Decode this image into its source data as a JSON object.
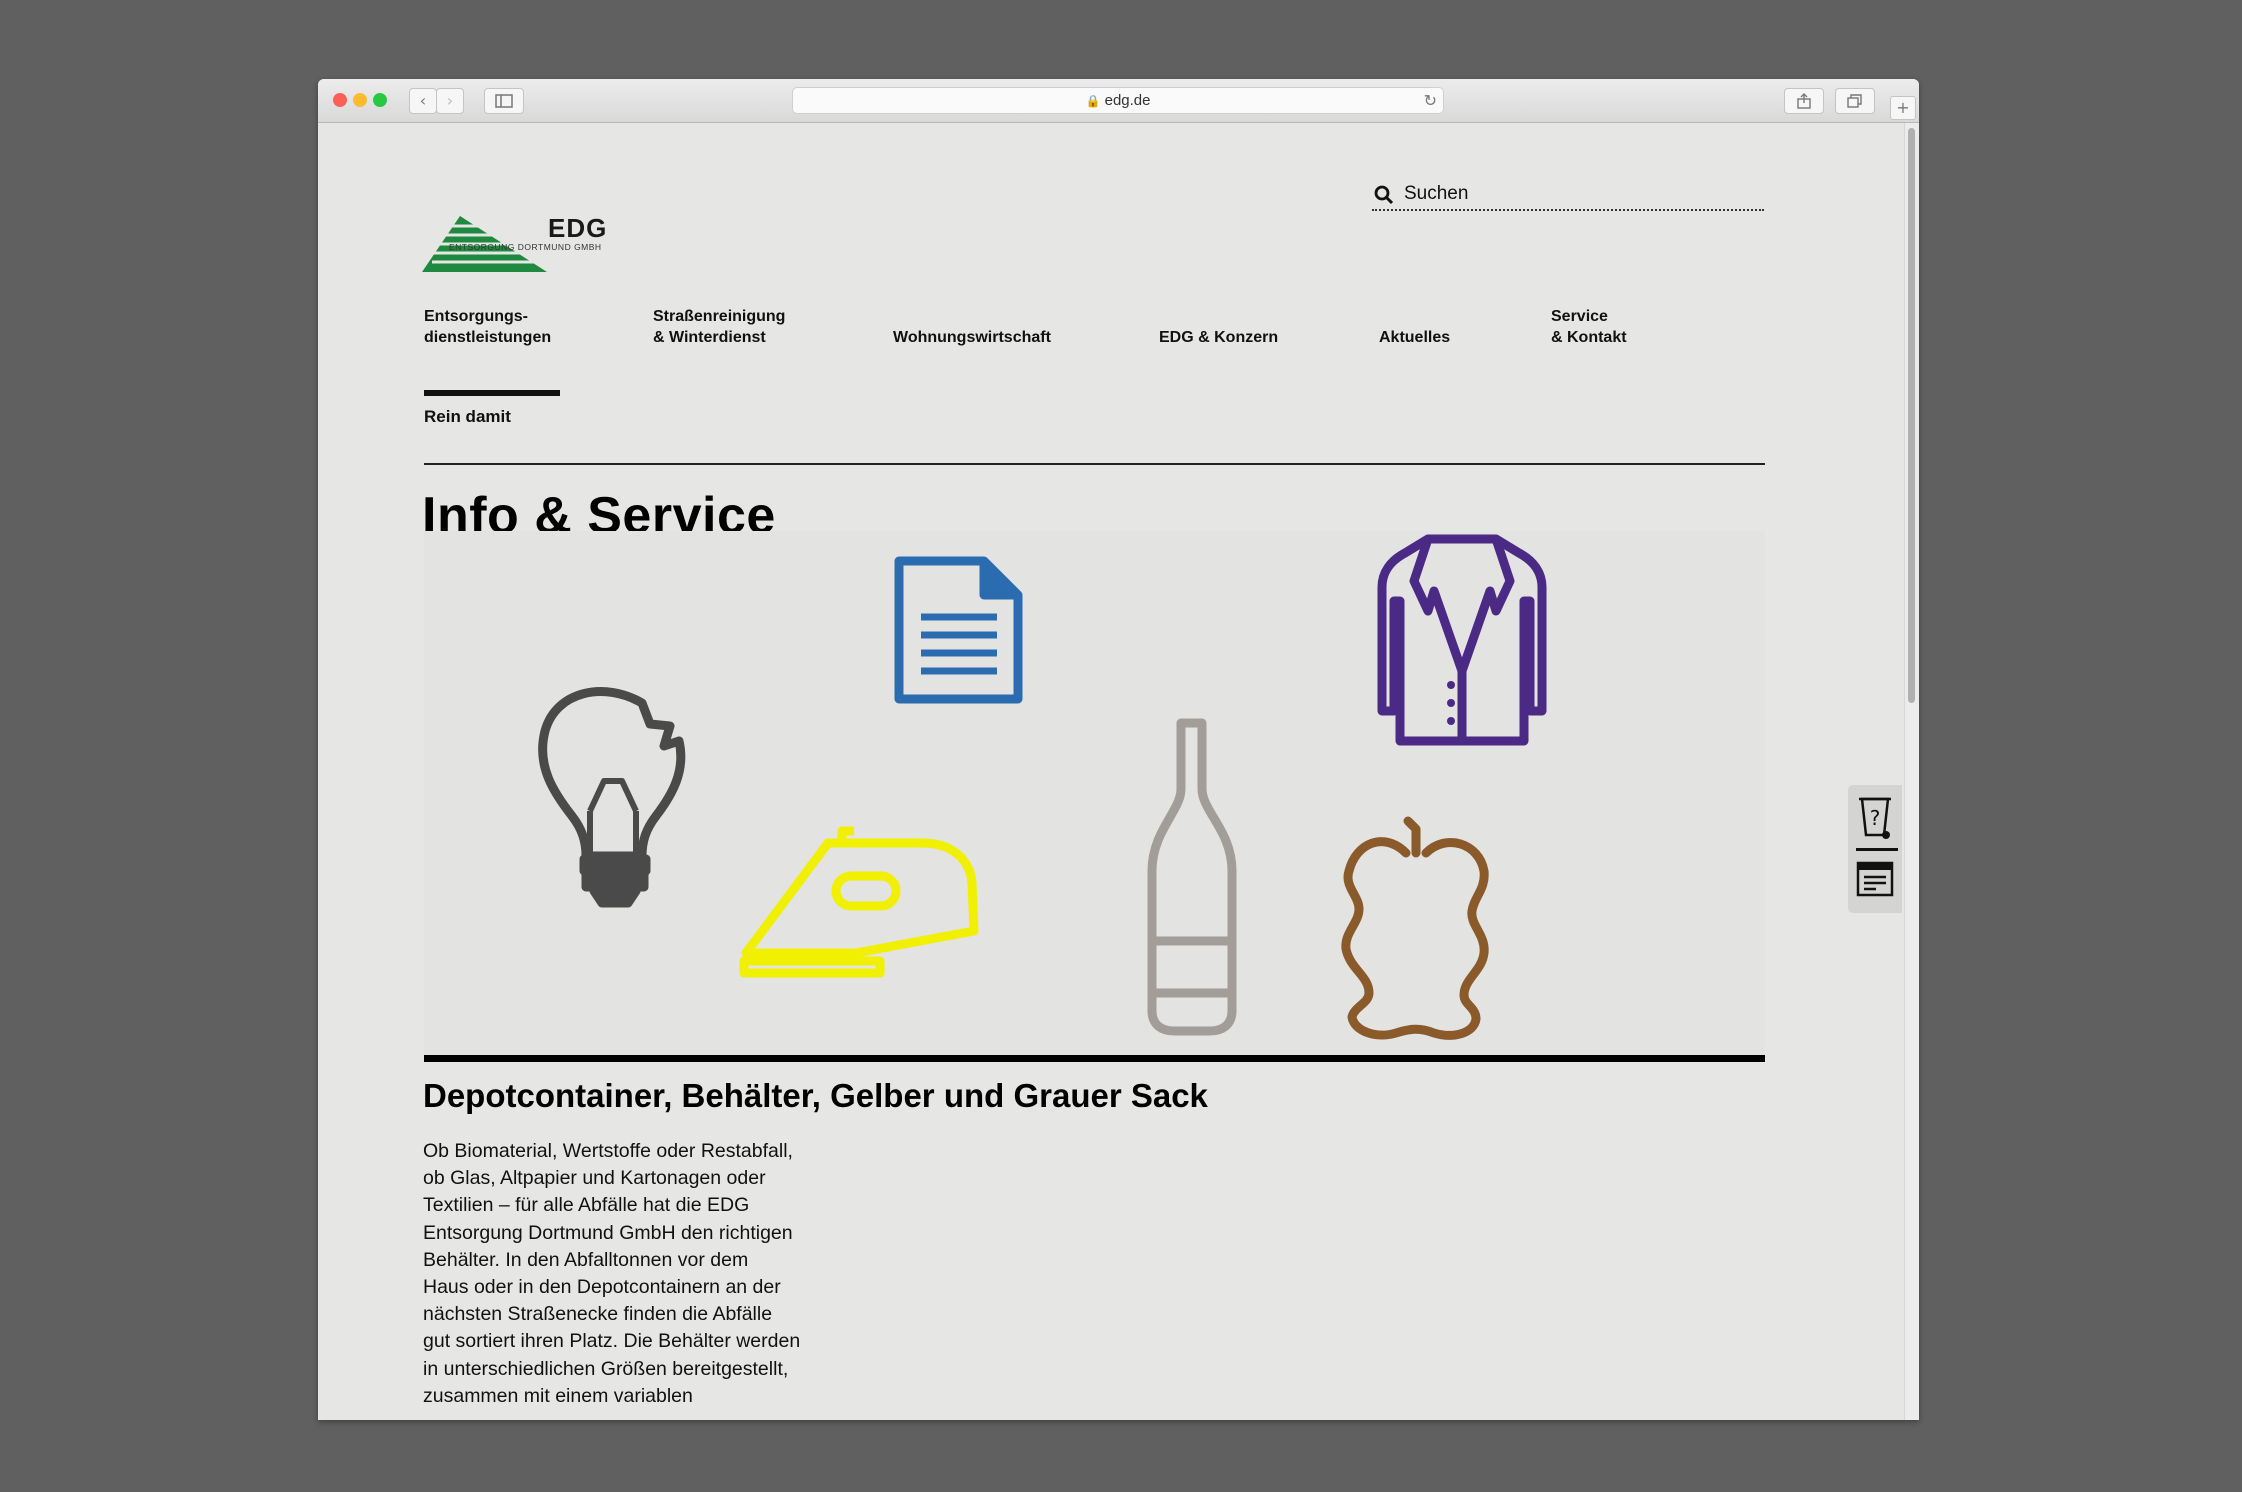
{
  "browser": {
    "url": "edg.de",
    "traffic_lights": [
      "#fc5f57",
      "#fdbc2e",
      "#28c840"
    ]
  },
  "header": {
    "logo_name": "EDG",
    "logo_subtitle": "ENTSORGUNG DORTMUND GMBH",
    "search_label": "Suchen"
  },
  "nav": {
    "items": [
      {
        "line1": "Entsorgungs-",
        "line2": "dienstleistungen"
      },
      {
        "line1": "Straßenreinigung",
        "line2": "& Winterdienst"
      },
      {
        "line1": "",
        "line2": "Wohnungswirtschaft"
      },
      {
        "line1": "",
        "line2": "EDG & Konzern"
      },
      {
        "line1": "",
        "line2": "Aktuelles"
      },
      {
        "line1": "Service",
        "line2": "& Kontakt"
      }
    ],
    "active_index": 0
  },
  "breadcrumb": "Rein damit",
  "page_title": "Info & Service",
  "hero_icons": [
    {
      "icon": "lightbulb-icon",
      "color": "#4a4a4a"
    },
    {
      "icon": "document-icon",
      "color": "#2b6cb0"
    },
    {
      "icon": "iron-icon",
      "color": "#f0f000"
    },
    {
      "icon": "bottle-icon",
      "color": "#a29d98"
    },
    {
      "icon": "apple-core-icon",
      "color": "#8a5a2b"
    },
    {
      "icon": "jacket-icon",
      "color": "#4b2a86"
    }
  ],
  "section": {
    "title": "Depotcontainer, Behälter, Gelber und Grauer Sack",
    "lines": [
      "Ob Biomaterial, Wertstoffe oder Restabfall,",
      "ob Glas, Altpapier und Kartonagen oder",
      "Textilien – für alle Abfälle hat die EDG",
      "Entsorgung Dortmund GmbH den richtigen",
      "Behälter. In den Abfalltonnen vor dem",
      "Haus oder in den Depotcontainern an der",
      "nächsten Straßenecke finden die Abfälle",
      "gut sortiert ihren Platz. Die Behälter werden",
      "in unterschiedlichen Größen bereitgestellt,",
      "zusammen mit einem variablen"
    ]
  },
  "side_tools": [
    {
      "icon": "bin-question-icon"
    },
    {
      "icon": "calendar-list-icon"
    }
  ]
}
